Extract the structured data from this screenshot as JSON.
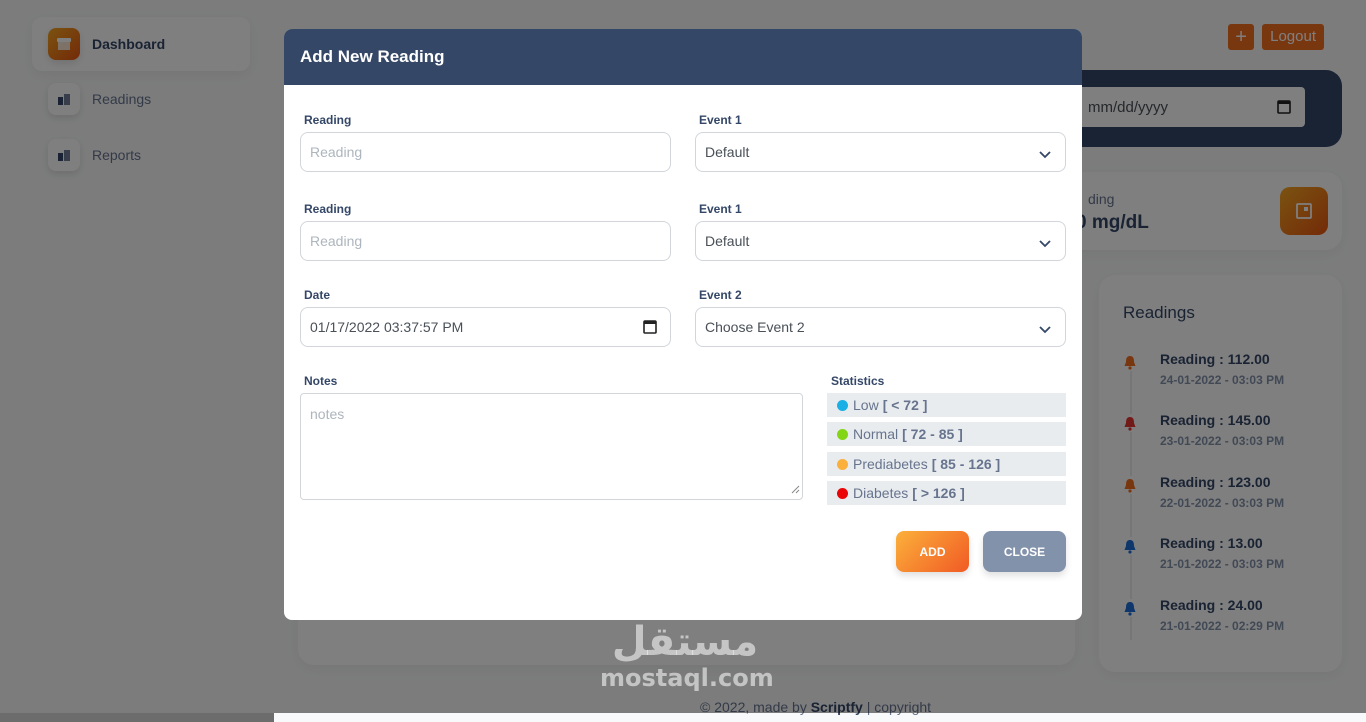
{
  "sidebar": {
    "items": [
      {
        "label": "Dashboard",
        "active": true
      },
      {
        "label": "Readings",
        "active": false
      },
      {
        "label": "Reports",
        "active": false
      }
    ]
  },
  "header": {
    "add_label": "+",
    "logout_label": "Logout",
    "date_placeholder": "mm/dd/yyyy"
  },
  "stat_card": {
    "label": "ding",
    "value": "0 mg/dL"
  },
  "readings_panel": {
    "title": "Readings",
    "items": [
      {
        "title": "Reading : 112.00",
        "date": "24-01-2022 - 03:03 PM",
        "bell_color": "#f36f21"
      },
      {
        "title": "Reading : 145.00",
        "date": "23-01-2022 - 03:03 PM",
        "bell_color": "#e53935"
      },
      {
        "title": "Reading : 123.00",
        "date": "22-01-2022 - 03:03 PM",
        "bell_color": "#f36f21"
      },
      {
        "title": "Reading : 13.00",
        "date": "21-01-2022 - 03:03 PM",
        "bell_color": "#1e6fd9"
      },
      {
        "title": "Reading : 24.00",
        "date": "21-01-2022 - 02:29 PM",
        "bell_color": "#1e6fd9"
      }
    ]
  },
  "footer": {
    "prefix": "© 2022, made by",
    "brand": "Scriptfy",
    "suffix": "| copyright"
  },
  "watermark": {
    "arabic": "مستقل",
    "latin": "mostaql.com"
  },
  "modal": {
    "title": "Add New Reading",
    "reading1": {
      "label": "Reading",
      "placeholder": "Reading"
    },
    "event1a": {
      "label": "Event 1",
      "value": "Default"
    },
    "reading2": {
      "label": "Reading",
      "placeholder": "Reading"
    },
    "event1b": {
      "label": "Event 1",
      "value": "Default"
    },
    "date": {
      "label": "Date",
      "value": "01/17/2022 03:37:57 PM"
    },
    "event2": {
      "label": "Event 2",
      "value": "Choose Event 2"
    },
    "notes": {
      "label": "Notes",
      "placeholder": "notes"
    },
    "statistics": {
      "label": "Statistics",
      "rows": [
        {
          "name": "Low",
          "range": "[ < 72 ]",
          "color": "#1ab0e6"
        },
        {
          "name": "Normal",
          "range": "[ 72 - 85 ]",
          "color": "#82d616"
        },
        {
          "name": "Prediabetes",
          "range": "[ 85 - 126 ]",
          "color": "#fbb03b"
        },
        {
          "name": "Diabetes",
          "range": "[ > 126 ]",
          "color": "#ea0606"
        }
      ]
    },
    "add_label": "ADD",
    "close_label": "CLOSE"
  }
}
